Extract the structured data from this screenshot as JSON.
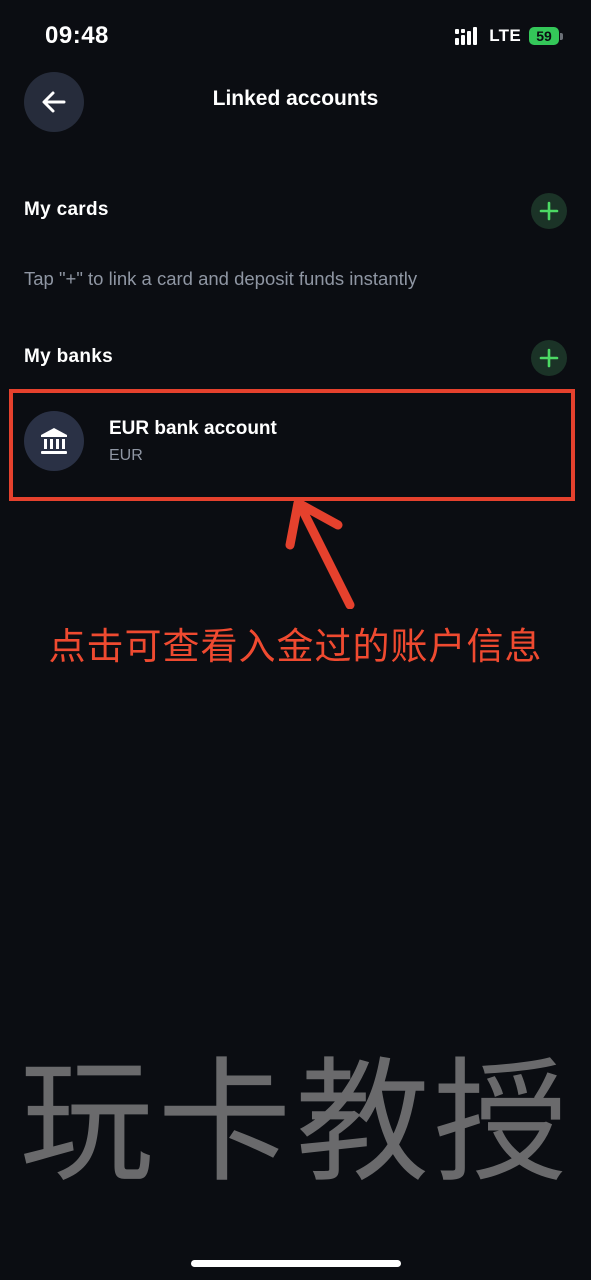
{
  "status_bar": {
    "time": "09:48",
    "network": "LTE",
    "battery": "59"
  },
  "header": {
    "title": "Linked accounts"
  },
  "cards_section": {
    "title": "My cards",
    "hint": "Tap \"+\" to link a card and deposit funds instantly"
  },
  "banks_section": {
    "title": "My banks",
    "items": [
      {
        "name": "EUR bank account",
        "currency": "EUR"
      }
    ]
  },
  "annotation": {
    "text": "点击可查看入金过的账户信息"
  },
  "watermark": {
    "text": "玩卡教授"
  },
  "colors": {
    "background": "#0b0d12",
    "accent_green": "#4cd964",
    "annotation_red": "#e5412d"
  }
}
